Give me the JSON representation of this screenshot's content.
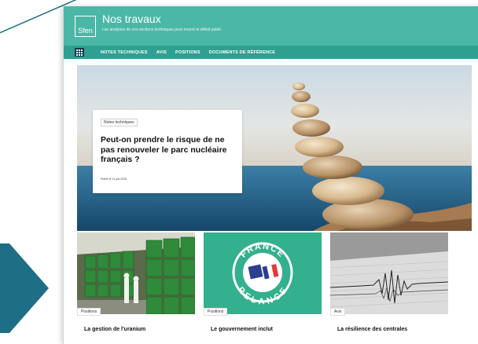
{
  "header": {
    "logo_text": "Sfen",
    "title": "Nos travaux",
    "subtitle": "Les analyses de nos sections techniques pour nourrir le débat public"
  },
  "nav": {
    "items": [
      "NOTES TECHNIQUES",
      "AVIS",
      "POSITIONS",
      "DOCUMENTS DE RÉFÉRENCE"
    ]
  },
  "hero": {
    "tag": "Notes techniques",
    "title": "Peut-on prendre le risque de ne pas renouveler le parc nucléaire français ?",
    "date": "Publié le 11 juin 2020"
  },
  "cards": [
    {
      "tag": "Positions",
      "title": "La gestion de l'uranium"
    },
    {
      "tag": "Positions",
      "title": "Le gouvernement inclut",
      "badge_text_top": "FRANCE",
      "badge_text_bottom": "RELANCE"
    },
    {
      "tag": "Avis",
      "title": "La résilience des centrales"
    }
  ],
  "colors": {
    "header": "#4bb8a7",
    "nav": "#2fa090",
    "menu_button": "#123a52",
    "deco_arrow": "#1e6e86",
    "relance_green": "#33b08e"
  },
  "icons": {
    "menu": "grid-menu-icon"
  }
}
